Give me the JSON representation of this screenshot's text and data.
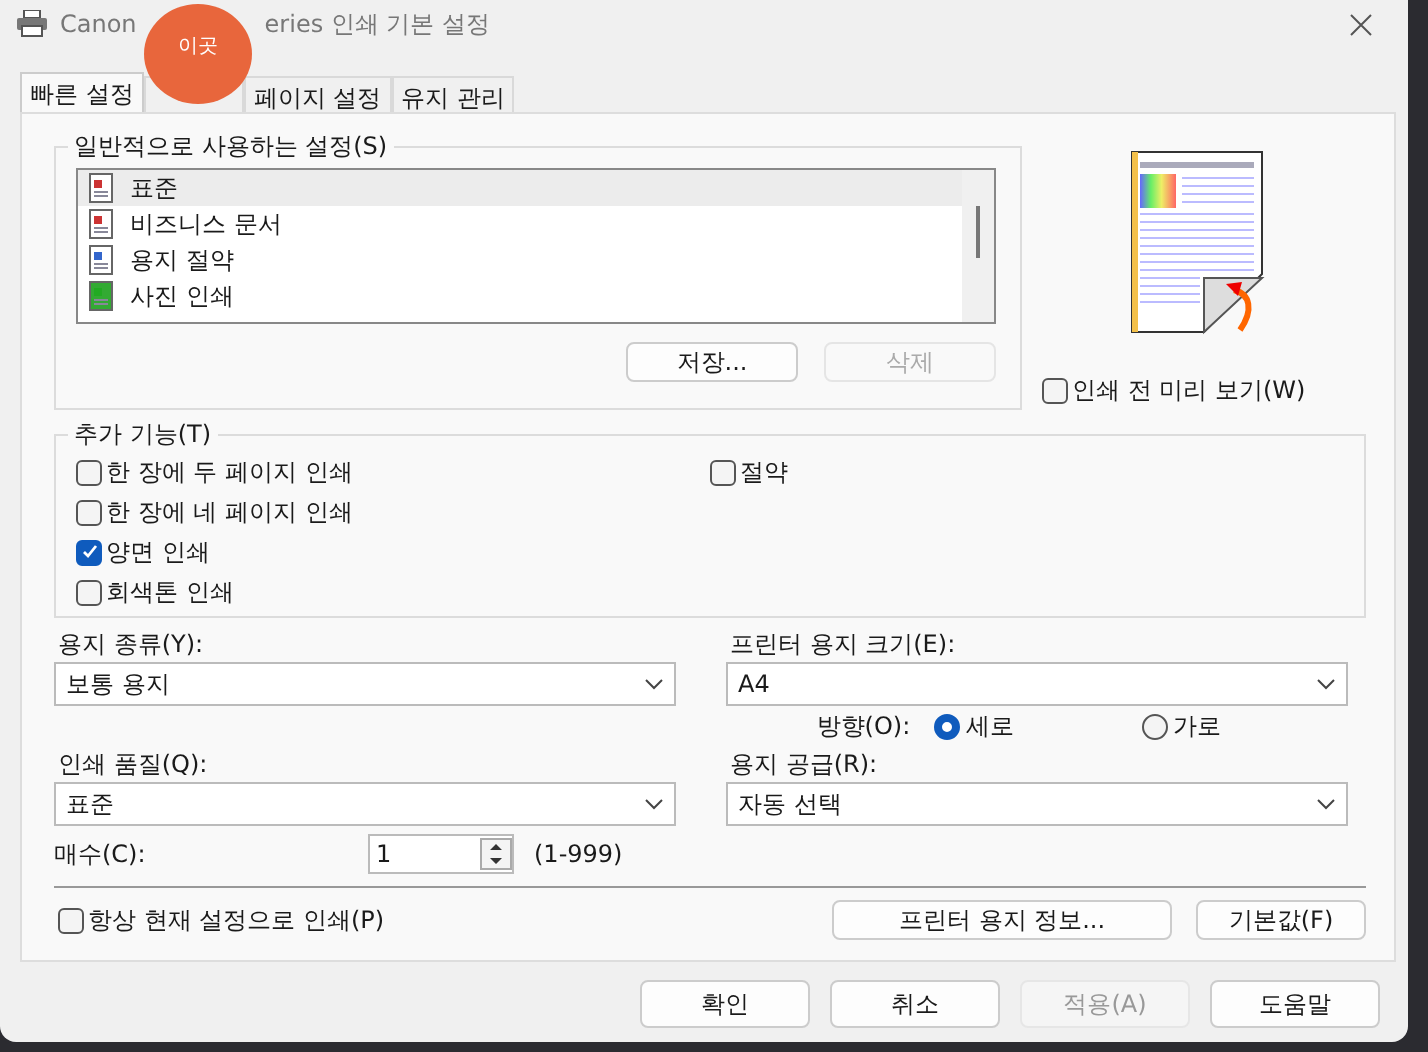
{
  "window": {
    "title_parts": [
      "Canon",
      "eries 인쇄 기본 설정"
    ]
  },
  "balloon": {
    "text": "이곳"
  },
  "tabs": [
    {
      "label": "빠른 설정",
      "selected": true
    },
    {
      "selected": false
    },
    {
      "label": "페이지 설정",
      "selected": false
    },
    {
      "label": "유지 관리",
      "selected": false
    }
  ],
  "presets": {
    "title": "일반적으로 사용하는 설정(S)",
    "items": [
      {
        "label": "표준",
        "kind": "standard",
        "selected": true
      },
      {
        "label": "비즈니스 문서",
        "kind": "business",
        "selected": false
      },
      {
        "label": "용지 절약",
        "kind": "saving",
        "selected": false
      },
      {
        "label": "사진 인쇄",
        "kind": "photo",
        "selected": false
      }
    ],
    "buttons": [
      {
        "label": "저장...",
        "disabled": false
      },
      {
        "label": "삭제",
        "disabled": true
      }
    ]
  },
  "preview_checkbox": {
    "label": "인쇄 전 미리 보기(W)",
    "checked": false
  },
  "features": {
    "title": "추가 기능(T)",
    "left": [
      {
        "label": "한 장에 두 페이지 인쇄",
        "checked": false
      },
      {
        "label": "한 장에 네 페이지 인쇄",
        "checked": false
      },
      {
        "label": "양면 인쇄",
        "checked": true
      },
      {
        "label": "회색톤 인쇄",
        "checked": false
      }
    ],
    "right": [
      {
        "label": "절약",
        "checked": false
      }
    ]
  },
  "media_type": {
    "label": "용지 종류(Y):",
    "value": "보통 용지"
  },
  "paper_size": {
    "label": "프린터 용지 크기(E):",
    "value": "A4"
  },
  "orientation": {
    "label": "방향(O):",
    "options": [
      {
        "label": "세로",
        "selected": true
      },
      {
        "label": "가로",
        "selected": false
      }
    ]
  },
  "quality": {
    "label": "인쇄 품질(Q):",
    "value": "표준"
  },
  "paper_source": {
    "label": "용지 공급(R):",
    "value": "자동 선택"
  },
  "copies": {
    "label": "매수(C):",
    "value": "1",
    "range": "(1-999)"
  },
  "always_print": {
    "label": "항상 현재 설정으로 인쇄(P)",
    "checked": false
  },
  "panel_buttons": [
    {
      "label": "프린터 용지 정보..."
    },
    {
      "label": "기본값(F)"
    }
  ],
  "dialog_buttons": [
    {
      "label": "확인",
      "disabled": false
    },
    {
      "label": "취소",
      "disabled": false
    },
    {
      "label": "적용(A)",
      "disabled": true
    },
    {
      "label": "도움말",
      "disabled": false
    }
  ]
}
